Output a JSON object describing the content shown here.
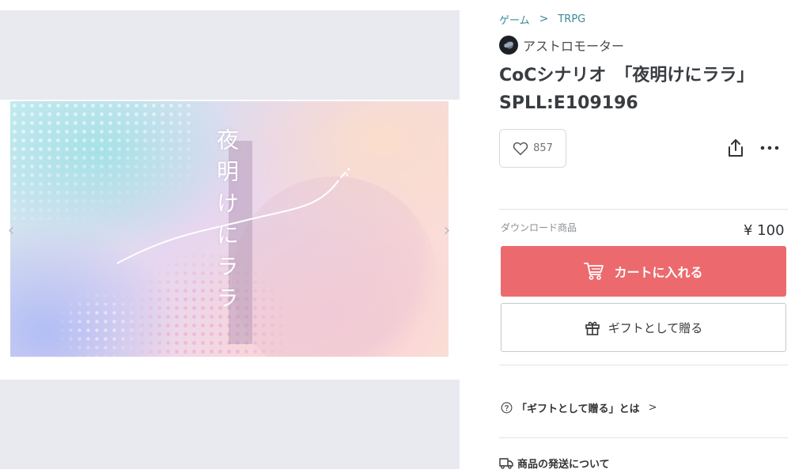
{
  "gallery": {
    "cover_title": "夜明けにララ",
    "prev_arrow": "‹",
    "next_arrow": "›"
  },
  "breadcrumb": {
    "items": [
      "ゲーム",
      "TRPG"
    ],
    "separator": ">"
  },
  "shop": {
    "name": "アストロモーター"
  },
  "product": {
    "title_line1": "CoCシナリオ　「夜明けにララ」",
    "title_line2": "SPLL:E109196"
  },
  "actions": {
    "like_count": "857",
    "share_icon": "share-icon",
    "more_icon": "more-icon"
  },
  "purchase": {
    "type_label": "ダウンロード商品",
    "price": "¥ 100",
    "cart_label": "カートに入れる",
    "gift_label": "ギフトとして贈る",
    "accent_color": "#ec6a6d"
  },
  "info": {
    "gift_about": "「ギフトとして贈る」とは",
    "gift_about_chevron": ">",
    "shipping": "商品の発送について"
  }
}
